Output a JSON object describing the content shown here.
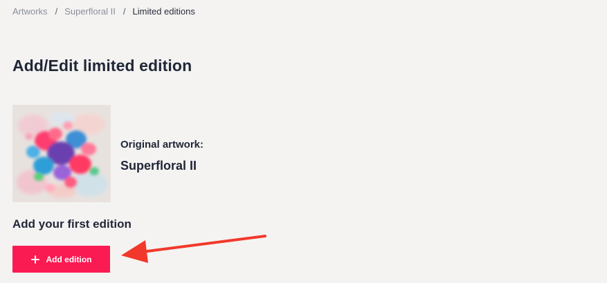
{
  "breadcrumb": {
    "items": [
      {
        "label": "Artworks"
      },
      {
        "label": "Superfloral II"
      }
    ],
    "separator": "/",
    "current": "Limited editions"
  },
  "page": {
    "title": "Add/Edit limited edition"
  },
  "artwork": {
    "label": "Original artwork:",
    "name": "Superfloral II",
    "thumbnail_icon": "abstract-painting-thumbnail"
  },
  "editions": {
    "heading": "Add your first edition",
    "add_button_label": "Add edition",
    "add_button_icon": "plus-icon"
  },
  "colors": {
    "accent": "#fb1b53",
    "annotation_arrow": "#f2382b",
    "background": "#f4f3f2",
    "text": "#1f2636",
    "muted_text": "#8a8f99"
  }
}
